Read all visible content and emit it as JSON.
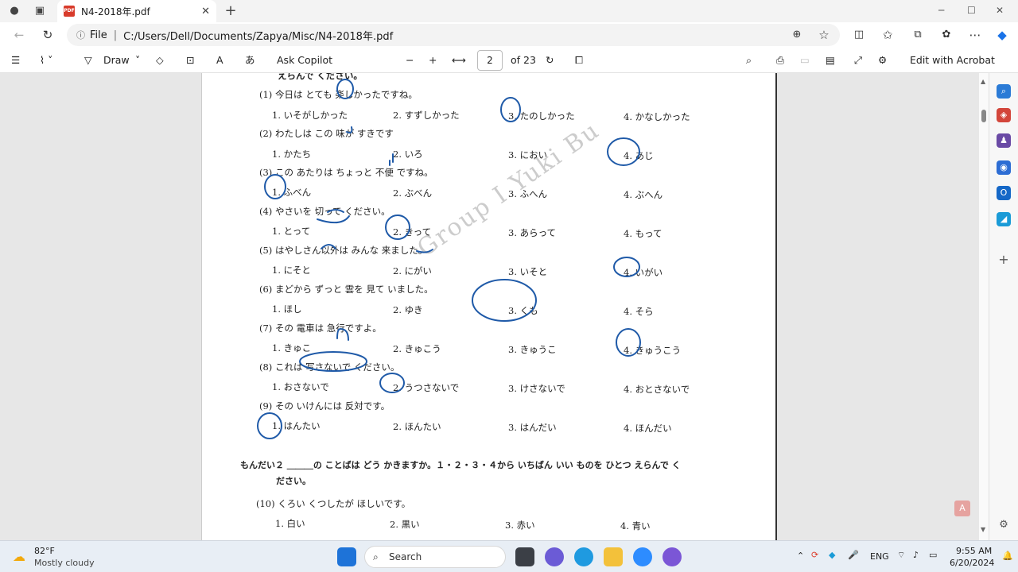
{
  "browser": {
    "tab_title": "N4-2018年.pdf",
    "url_label": "File",
    "url": "C:/Users/Dell/Documents/Zapya/Misc/N4-2018年.pdf"
  },
  "toolbar": {
    "draw": "Draw",
    "ask_copilot": "Ask Copilot",
    "page": "2",
    "of_pages": "of 23",
    "edit_acrobat": "Edit with Acrobat",
    "aa": "A",
    "char": "あ"
  },
  "pdf": {
    "top": "えらんで ください。",
    "q1": "(1) 今日は とても 楽しかったですね。",
    "q1o": [
      "1. いそがしかった",
      "2. すずしかった",
      "3. たのしかった",
      "4. かなしかった"
    ],
    "q2": "(2) わたしは この 味が すきです",
    "q2o": [
      "1. かたち",
      "2. いろ",
      "3. におい",
      "4. あじ"
    ],
    "q3": "(3) この あたりは ちょっと 不便 ですね。",
    "q3o": [
      "1. ふべん",
      "2. ぶべん",
      "3. ふへん",
      "4. ぶへん"
    ],
    "q4": "(4) やさいを 切って ください。",
    "q4o": [
      "1. とって",
      "2. きって",
      "3. あらって",
      "4. もって"
    ],
    "q5": "(5) はやしさん以外は みんな 来ました。",
    "q5o": [
      "1. にそと",
      "2. にがい",
      "3. いそと",
      "4. いがい"
    ],
    "q6": "(6) まどから ずっと 雲を 見て いました。",
    "q6o": [
      "1. ほし",
      "2. ゆき",
      "3. くも",
      "4. そら"
    ],
    "q7": "(7) その 電車は 急行ですよ。",
    "q7o": [
      "1. きゅこ",
      "2. きゅこう",
      "3. きゅうこ",
      "4. きゅうこう"
    ],
    "q8": "(8) これは 写さないで ください。",
    "q8o": [
      "1. おさないで",
      "2. うつさないで",
      "3. けさないで",
      "4. おとさないで"
    ],
    "q9": "(9) その いけんには 反対です。",
    "q9o": [
      "1. はんたい",
      "2. ほんたい",
      "3. はんだい",
      "4. ほんだい"
    ],
    "mondai2": "もんだい２ ＿＿＿の ことばは どう かきますか。１・２・３・４から いちばん いい ものを ひとつ えらんで く",
    "mondai2b": "ださい。",
    "q10": "(10) くろい くつしたが ほしいです。",
    "q10o": [
      "1. 白い",
      "2. 黒い",
      "3. 赤い",
      "4. 青い"
    ],
    "watermark": "Group I Yuki Bu"
  },
  "taskbar": {
    "temp": "82°F",
    "weather": "Mostly cloudy",
    "search": "Search",
    "lang": "ENG",
    "time": "9:55 AM",
    "date": "6/20/2024"
  }
}
